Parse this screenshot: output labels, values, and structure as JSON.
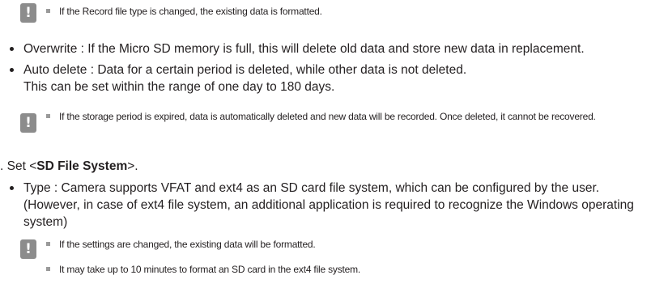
{
  "notes": {
    "n1": [
      "If the Record file type is changed, the existing data is formatted."
    ],
    "n2": [
      "If the storage period is expired, data is automatically deleted and new data will be recorded. Once deleted, it cannot be recovered."
    ],
    "n3": [
      "If the settings are changed, the existing data will be formatted.",
      "It may take up to 10 minutes to format an SD card in the ext4 file system."
    ]
  },
  "bullets": {
    "overwrite": "Overwrite : If the Micro SD memory is full, this will delete old data and store new data in replacement.",
    "auto_delete_1": "Auto delete : Data for a certain period is deleted, while other data is not deleted.",
    "auto_delete_2": "This can be set within the range of one day to 180 days.",
    "type": "Type : Camera supports VFAT and ext4 as an SD card file system, which can be configured by the user. (However, in case of ext4 file system, an additional application is required to recognize the Windows operating system)"
  },
  "step": {
    "number": ".",
    "prefix": "Set <",
    "bold": "SD File System",
    "suffix": ">."
  },
  "icon": {
    "name": "caution-icon",
    "glyph": "!"
  }
}
